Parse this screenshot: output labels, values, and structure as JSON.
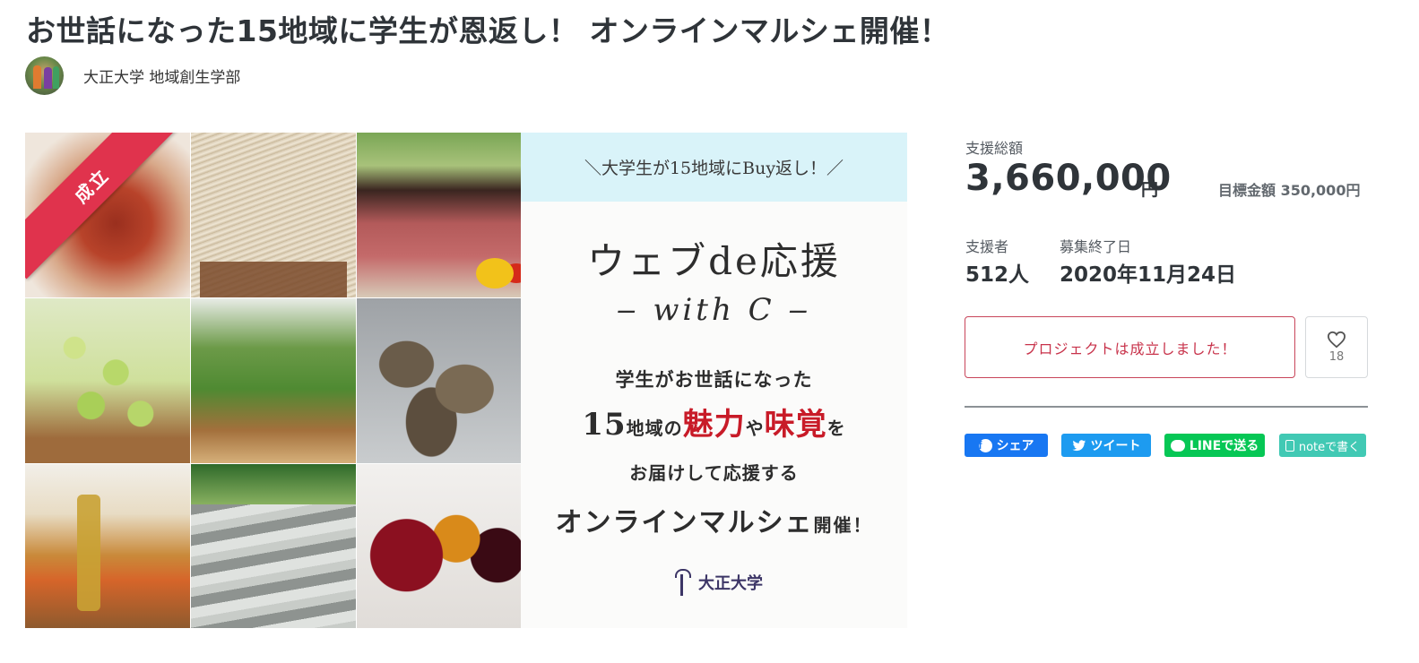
{
  "project": {
    "title": "お世話になった15地域に学生が恩返し！ オンラインマルシェ開催！",
    "owner_name": "大正大学 地域創生学部"
  },
  "hero": {
    "badge": "成立",
    "banner_lines": {
      "header": "＼大学生が15地域にBuy返し！／",
      "line1": "ウェブde応援",
      "line2": "‒ with C ‒",
      "line3": "学生がお世話になった",
      "line4_a": "15",
      "line4_b": "地域の",
      "line4_c": "魅力",
      "line4_d": "や",
      "line4_e": "味覚",
      "line4_f": "を",
      "line5": "お届けして応援する",
      "line6_a": "オンラインマルシェ",
      "line6_b": "開催！",
      "logo_text": "大正大学"
    }
  },
  "stats": {
    "total_label": "支援総額",
    "total_amount": "3,660,000",
    "yen": "円",
    "goal": "目標金額 350,000円",
    "supporters_label": "支援者",
    "supporters_value": "512人",
    "end_label": "募集終了日",
    "end_value": "2020年11月24日"
  },
  "actions": {
    "status_label": "プロジェクトは成立しました！",
    "like_count": "18"
  },
  "share": {
    "facebook": "シェア",
    "twitter": "ツイート",
    "line": "LINEで送る",
    "note": "noteで書く"
  },
  "icons": {
    "heart": "heart-icon",
    "facebook": "facebook-icon",
    "twitter": "twitter-icon",
    "line": "line-icon",
    "note": "note-icon"
  },
  "colors": {
    "accent_red": "#e0334d",
    "facebook": "#1877f2",
    "twitter": "#1d9bf0",
    "line": "#06c755",
    "note": "#41c9b4"
  }
}
